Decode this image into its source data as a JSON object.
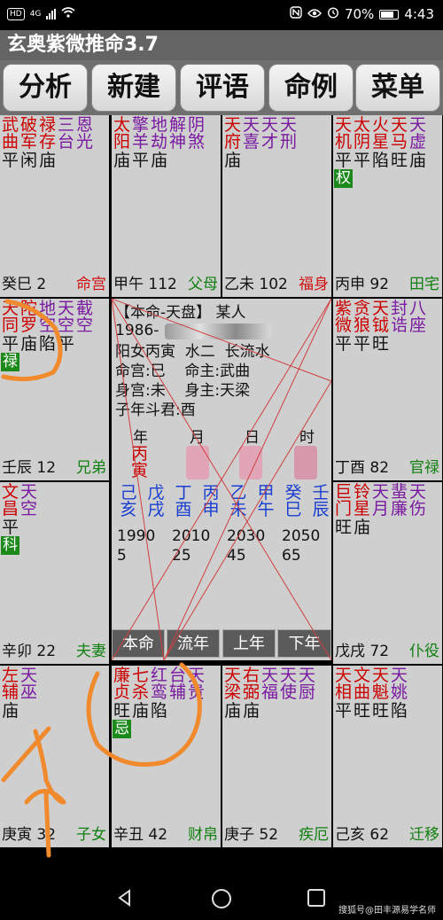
{
  "statusbar": {
    "left_tag": "HD",
    "net": "4G",
    "battery": "70%",
    "time": "4:43"
  },
  "app": {
    "title": "玄奥紫微推命3.7"
  },
  "toolbar": [
    "分析",
    "新建",
    "评语",
    "命例",
    "菜单"
  ],
  "palaces": [
    {
      "id": "si",
      "stars": [
        [
          "武",
          "曲",
          "#cc0000"
        ],
        [
          "破",
          "军",
          "#cc0000"
        ],
        [
          "禄",
          "存",
          "#cc0000"
        ],
        [
          "三",
          "台",
          "#7a1aa0"
        ],
        [
          "恩",
          "光",
          "#7a1aa0"
        ]
      ],
      "bright": [
        "平",
        "闲",
        "庙"
      ],
      "hua": "",
      "ganzhi": "癸巳",
      "age": "2",
      "palace": "命宫",
      "palace_color": "#d01010"
    },
    {
      "id": "wu",
      "stars": [
        [
          "太",
          "阳",
          "#cc0000"
        ],
        [
          "擎",
          "羊",
          "#7a1aa0"
        ],
        [
          "地",
          "劫",
          "#7a1aa0"
        ],
        [
          "解",
          "神",
          "#7a1aa0"
        ],
        [
          "阴",
          "煞",
          "#7a1aa0"
        ]
      ],
      "bright": [
        "庙",
        "平",
        "庙"
      ],
      "hua": "",
      "ganzhi": "甲午",
      "age": "112",
      "palace": "父母",
      "palace_color": "#108010"
    },
    {
      "id": "wei",
      "stars": [
        [
          "天",
          "府",
          "#cc0000"
        ],
        [
          "天",
          "喜",
          "#7a1aa0"
        ],
        [
          "天",
          "才",
          "#7a1aa0"
        ],
        [
          "天",
          "刑",
          "#7a1aa0"
        ]
      ],
      "bright": [
        "庙"
      ],
      "hua": "",
      "ganzhi": "乙未",
      "age": "102",
      "palace": "福身",
      "palace_color": "#d01010"
    },
    {
      "id": "shen",
      "stars": [
        [
          "天",
          "机",
          "#cc0000"
        ],
        [
          "太",
          "阴",
          "#cc0000"
        ],
        [
          "火",
          "星",
          "#cc0000"
        ],
        [
          "天",
          "马",
          "#cc0000"
        ],
        [
          "天",
          "虚",
          "#7a1aa0"
        ]
      ],
      "bright": [
        "平",
        "平",
        "陷",
        "旺",
        "庙"
      ],
      "hua": "权",
      "hua_col": 0,
      "ganzhi": "丙申",
      "age": "92",
      "palace": "田宅",
      "palace_color": "#108010"
    },
    {
      "id": "chen",
      "stars": [
        [
          "天",
          "同",
          "#cc0000"
        ],
        [
          "陀",
          "罗",
          "#cc0000"
        ],
        [
          "地",
          "空",
          "#7a1aa0"
        ],
        [
          "天",
          "空",
          "#7a1aa0"
        ],
        [
          "截",
          "空",
          "#7a1aa0"
        ]
      ],
      "bright": [
        "平",
        "庙",
        "陷",
        "平"
      ],
      "hua": "禄",
      "hua_col": 0,
      "ganzhi": "壬辰",
      "age": "12",
      "palace": "兄弟",
      "palace_color": "#108010"
    },
    {
      "id": "you",
      "stars": [
        [
          "紫",
          "微",
          "#cc0000"
        ],
        [
          "贪",
          "狼",
          "#cc0000"
        ],
        [
          "天",
          "钺",
          "#cc0000"
        ],
        [
          "封",
          "诰",
          "#7a1aa0"
        ],
        [
          "八",
          "座",
          "#7a1aa0"
        ]
      ],
      "bright": [
        "平",
        "平",
        "旺"
      ],
      "hua": "",
      "ganzhi": "丁酉",
      "age": "82",
      "palace": "官禄",
      "palace_color": "#108010"
    },
    {
      "id": "mao",
      "stars": [
        [
          "文",
          "昌",
          "#cc0000"
        ],
        [
          "天",
          "空",
          "#7a1aa0"
        ]
      ],
      "bright": [
        "平"
      ],
      "hua": "科",
      "hua_col": 0,
      "ganzhi": "辛卯",
      "age": "22",
      "palace": "夫妻",
      "palace_color": "#108010"
    },
    {
      "id": "xu",
      "stars": [
        [
          "巨",
          "门",
          "#cc0000"
        ],
        [
          "铃",
          "星",
          "#cc0000"
        ],
        [
          "天",
          "月",
          "#7a1aa0"
        ],
        [
          "蜚",
          "廉",
          "#7a1aa0"
        ],
        [
          "天",
          "伤",
          "#7a1aa0"
        ]
      ],
      "bright": [
        "旺",
        "庙"
      ],
      "hua": "",
      "ganzhi": "戊戌",
      "age": "72",
      "palace": "仆役",
      "palace_color": "#108010"
    },
    {
      "id": "yin",
      "stars": [
        [
          "左",
          "辅",
          "#cc0000"
        ],
        [
          "天",
          "巫",
          "#7a1aa0"
        ]
      ],
      "bright": [
        "庙"
      ],
      "hua": "",
      "ganzhi": "庚寅",
      "age": "32",
      "palace": "子女",
      "palace_color": "#108010"
    },
    {
      "id": "chou",
      "stars": [
        [
          "廉",
          "贞",
          "#cc0000"
        ],
        [
          "七",
          "杀",
          "#cc0000"
        ],
        [
          "红",
          "鸾",
          "#7a1aa0"
        ],
        [
          "台",
          "辅",
          "#7a1aa0"
        ],
        [
          "天",
          "贵",
          "#7a1aa0"
        ]
      ],
      "bright": [
        "旺",
        "庙",
        "陷"
      ],
      "hua": "忌",
      "hua_col": 0,
      "ganzhi": "辛丑",
      "age": "42",
      "palace": "财帛",
      "palace_color": "#108010"
    },
    {
      "id": "zi",
      "stars": [
        [
          "天",
          "梁",
          "#cc0000"
        ],
        [
          "右",
          "弼",
          "#cc0000"
        ],
        [
          "天",
          "福",
          "#7a1aa0"
        ],
        [
          "天",
          "使",
          "#7a1aa0"
        ],
        [
          "天",
          "厨",
          "#7a1aa0"
        ]
      ],
      "bright": [
        "庙",
        "庙"
      ],
      "hua": "",
      "ganzhi": "庚子",
      "age": "52",
      "palace": "疾厄",
      "palace_color": "#108010"
    },
    {
      "id": "hai",
      "stars": [
        [
          "天",
          "相",
          "#cc0000"
        ],
        [
          "文",
          "曲",
          "#cc0000"
        ],
        [
          "天",
          "魁",
          "#cc0000"
        ],
        [
          "天",
          "姚",
          "#7a1aa0"
        ]
      ],
      "bright": [
        "平",
        "旺",
        "旺",
        "陷"
      ],
      "hua": "",
      "ganzhi": "己亥",
      "age": "62",
      "palace": "迁移",
      "palace_color": "#108010"
    }
  ],
  "center": {
    "line1": "【本命-天盘】 某人",
    "line2": "1986-",
    "line3": "阳女丙寅  水二  长流水",
    "line4": "命宫:巳    命主:武曲",
    "line5": "身宫:未    身主:天梁",
    "line6": "子年斗君:酉",
    "cols": [
      "年",
      "月",
      "日",
      "时"
    ],
    "year_gz": [
      "丙",
      "寅"
    ],
    "dayun_gz": [
      [
        "己",
        "亥"
      ],
      [
        "戊",
        "戌"
      ],
      [
        "丁",
        "酉"
      ],
      [
        "丙",
        "申"
      ],
      [
        "乙",
        "未"
      ],
      [
        "甲",
        "午"
      ],
      [
        "癸",
        "巳"
      ],
      [
        "壬",
        "辰"
      ]
    ],
    "dayun_years_top": [
      "1990",
      "2010",
      "2030",
      "2050"
    ],
    "dayun_years_bottom": [
      "5",
      "25",
      "45",
      "65"
    ],
    "tabs": [
      "本命",
      "流年",
      "上年",
      "下年"
    ]
  },
  "nav": {
    "back": "back",
    "home": "home",
    "recent": "recent"
  },
  "watermark": "搜狐号@田丰源易学名师"
}
